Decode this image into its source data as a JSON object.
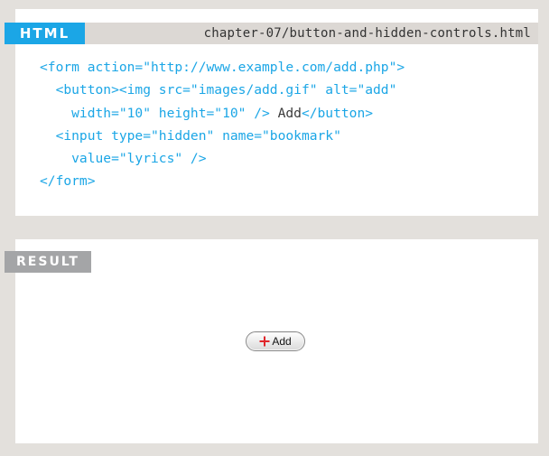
{
  "html_panel": {
    "tag_label": "HTML",
    "filename": "chapter-07/button-and-hidden-controls.html",
    "code_lines": [
      {
        "parts": [
          {
            "t": "<form action=\"http://www.example.com/add.php\">",
            "c": "blue"
          }
        ]
      },
      {
        "parts": [
          {
            "t": "  <button><img src=\"images/add.gif\" alt=\"add\"",
            "c": "blue"
          }
        ]
      },
      {
        "parts": [
          {
            "t": "    width=\"10\" height=\"10\" /> ",
            "c": "blue"
          },
          {
            "t": "Add",
            "c": "dark"
          },
          {
            "t": "</button>",
            "c": "blue"
          }
        ]
      },
      {
        "parts": [
          {
            "t": "  <input type=\"hidden\" name=\"bookmark\"",
            "c": "blue"
          }
        ]
      },
      {
        "parts": [
          {
            "t": "    value=\"lyrics\" />",
            "c": "blue"
          }
        ]
      },
      {
        "parts": [
          {
            "t": "</form>",
            "c": "blue"
          }
        ]
      }
    ]
  },
  "result_panel": {
    "tag_label": "RESULT",
    "button_label": "Add",
    "button_icon": "plus-icon"
  },
  "colors": {
    "accent_blue": "#1ba6e6",
    "result_gray": "#a4a5a7",
    "background": "#e3e0dc"
  }
}
